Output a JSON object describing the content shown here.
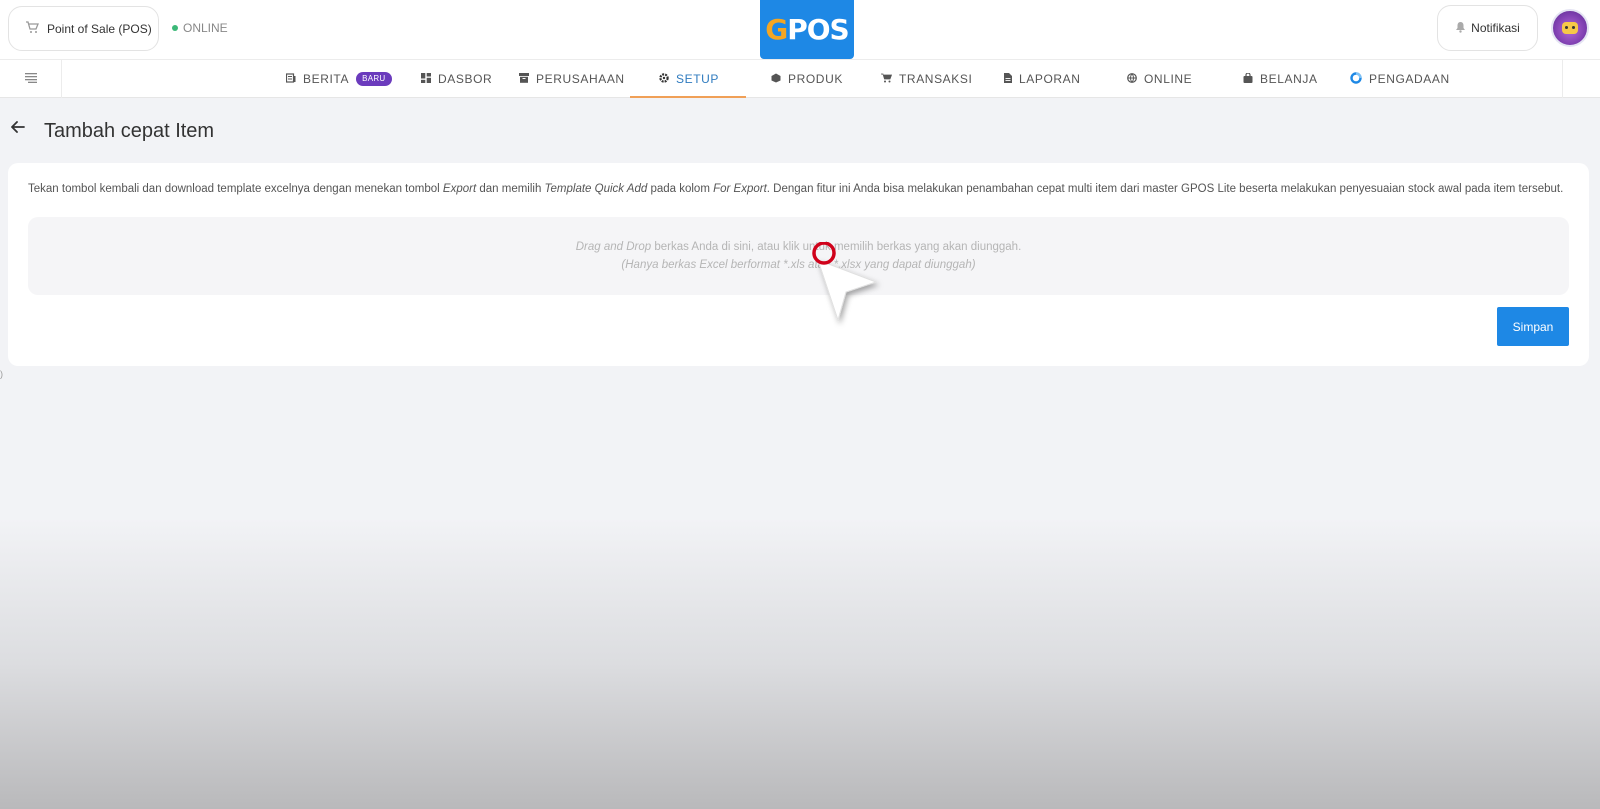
{
  "header": {
    "pos_label": "Point of Sale (POS)",
    "status_label": "ONLINE",
    "logo_g": "G",
    "logo_rest": "POS",
    "notif_label": "Notifikasi"
  },
  "nav": {
    "items": [
      {
        "label": "BERITA",
        "icon": "newspaper-icon"
      },
      {
        "label": "DASBOR",
        "icon": "dashboard-icon"
      },
      {
        "label": "PERUSAHAAN",
        "icon": "building-icon"
      },
      {
        "label": "SETUP",
        "icon": "gear-icon",
        "active": true
      },
      {
        "label": "PRODUK",
        "icon": "box-icon"
      },
      {
        "label": "TRANSAKSI",
        "icon": "cart-icon"
      },
      {
        "label": "LAPORAN",
        "icon": "document-icon"
      },
      {
        "label": "ONLINE",
        "icon": "globe-icon"
      },
      {
        "label": "BELANJA",
        "icon": "shopping-bag-icon"
      },
      {
        "label": "PENGADAAN",
        "icon": "procurement-icon"
      }
    ],
    "badge_label": "BARU"
  },
  "page": {
    "title": "Tambah cepat Item"
  },
  "card": {
    "desc": {
      "p1": "Tekan tombol kembali dan download template excelnya dengan menekan tombol ",
      "em1": "Export",
      "p2": " dan memilih ",
      "em2": "Template Quick Add",
      "p3": " pada kolom ",
      "em3": "For Export",
      "p4": ". Dengan fitur ini Anda bisa melakukan penambahan cepat multi item dari master GPOS Lite beserta melakukan penyesuaian stock awal pada item tersebut."
    },
    "dropzone": {
      "em": "Drag and Drop",
      "line1": " berkas Anda di sini, atau klik untuk memilih berkas yang akan diunggah.",
      "line2": "(Hanya berkas Excel berformat *.xls atau *.xlsx yang dapat diunggah)"
    },
    "save_label": "Simpan"
  },
  "colors": {
    "primary": "#1e88e5",
    "active_nav": "#2f7bbf",
    "nav_underline": "#f0a057",
    "badge": "#6b3bbd",
    "online_dot": "#3cb878",
    "cursor_ring": "#d0021b"
  },
  "misc_mark": ")"
}
